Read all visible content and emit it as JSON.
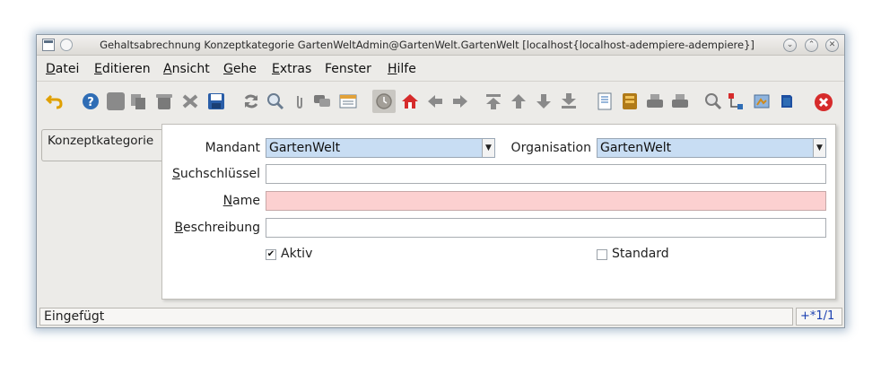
{
  "window": {
    "title": "Gehaltsabrechnung Konzeptkategorie  GartenWeltAdmin@GartenWelt.GartenWelt [localhost{localhost-adempiere-adempiere}]",
    "buttons": {
      "minimize": "⌄",
      "maximize": "⌃",
      "close": "✕"
    }
  },
  "menu": [
    {
      "mnemonic": "D",
      "rest": "atei"
    },
    {
      "mnemonic": "E",
      "rest": "ditieren"
    },
    {
      "mnemonic": "A",
      "rest": "nsicht"
    },
    {
      "mnemonic": "G",
      "rest": "ehe"
    },
    {
      "mnemonic": "E",
      "rest": "xtras"
    },
    {
      "mnemonic": "",
      "rest": "Fenster"
    },
    {
      "mnemonic": "H",
      "rest": "ilfe"
    }
  ],
  "toolbar_icons": [
    "undo-icon",
    "help-icon",
    "new-record-icon",
    "copy-record-icon",
    "delete-icon",
    "delete-selection-icon",
    "save-icon",
    "refresh-icon",
    "find-icon",
    "attachment-icon",
    "chat-icon",
    "grid-toggle-icon",
    "history-icon",
    "home-icon",
    "previous-tab-icon",
    "next-tab-icon",
    "first-record-icon",
    "previous-record-icon",
    "next-record-icon",
    "last-record-icon",
    "report-icon",
    "archive-icon",
    "print-preview-icon",
    "print-icon",
    "zoom-across-icon",
    "workflow-icon",
    "product-info-icon",
    "info-window-icon",
    "exit-icon"
  ],
  "tab": {
    "label": "Konzeptkategorie"
  },
  "form": {
    "mandant": {
      "label": "Mandant",
      "value": "GartenWelt"
    },
    "organisation": {
      "label": "Organisation",
      "value": "GartenWelt"
    },
    "suchschluessel": {
      "mnemonic": "S",
      "rest": "uchschlüssel",
      "value": ""
    },
    "name": {
      "mnemonic": "N",
      "rest": "ame",
      "value": ""
    },
    "beschreibung": {
      "mnemonic": "B",
      "rest": "eschreibung",
      "value": ""
    },
    "aktiv": {
      "label": "Aktiv",
      "checked": true,
      "mark": "✔"
    },
    "standard": {
      "label": "Standard",
      "checked": false,
      "mark": ""
    }
  },
  "status": {
    "message": "Eingefügt",
    "record_nav": "+*1/1"
  },
  "colors": {
    "accent": "#c8ddf3",
    "mandatory": "#fcd0d0",
    "exit": "#d62b2b"
  }
}
